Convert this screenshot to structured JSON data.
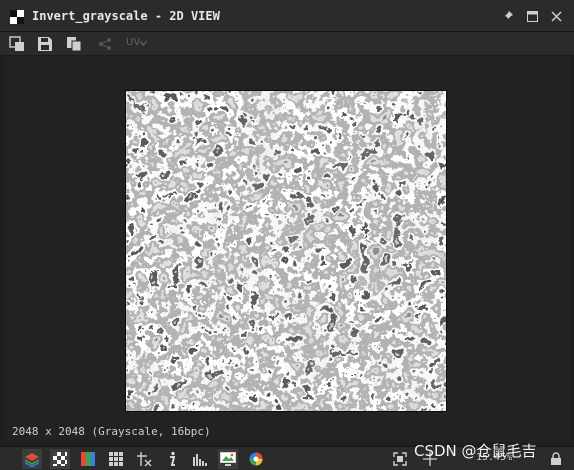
{
  "window": {
    "title": "Invert_grayscale - 2D VIEW",
    "icons": [
      "view-2d-icon",
      "pin-icon",
      "maximize-icon",
      "close-icon"
    ]
  },
  "toolbar": {
    "icons": [
      "export-view-icon",
      "save-icon",
      "copy-icon",
      "share-icon"
    ],
    "uv_label": "UV"
  },
  "viewport": {
    "image_info": "2048 x 2048 (Grayscale, 16bpc)"
  },
  "bottom_bar": {
    "icons": [
      "layers-icon",
      "checker-icon",
      "color-gradient-icon",
      "grid-icon",
      "tile-icon",
      "info-icon",
      "histogram-icon",
      "display-icon",
      "color-wheel-icon",
      "fit-view-icon",
      "pan-icon",
      "lock-icon"
    ],
    "zoom": "15.45%"
  },
  "watermark": "CSDN @仓鼠毛吉"
}
